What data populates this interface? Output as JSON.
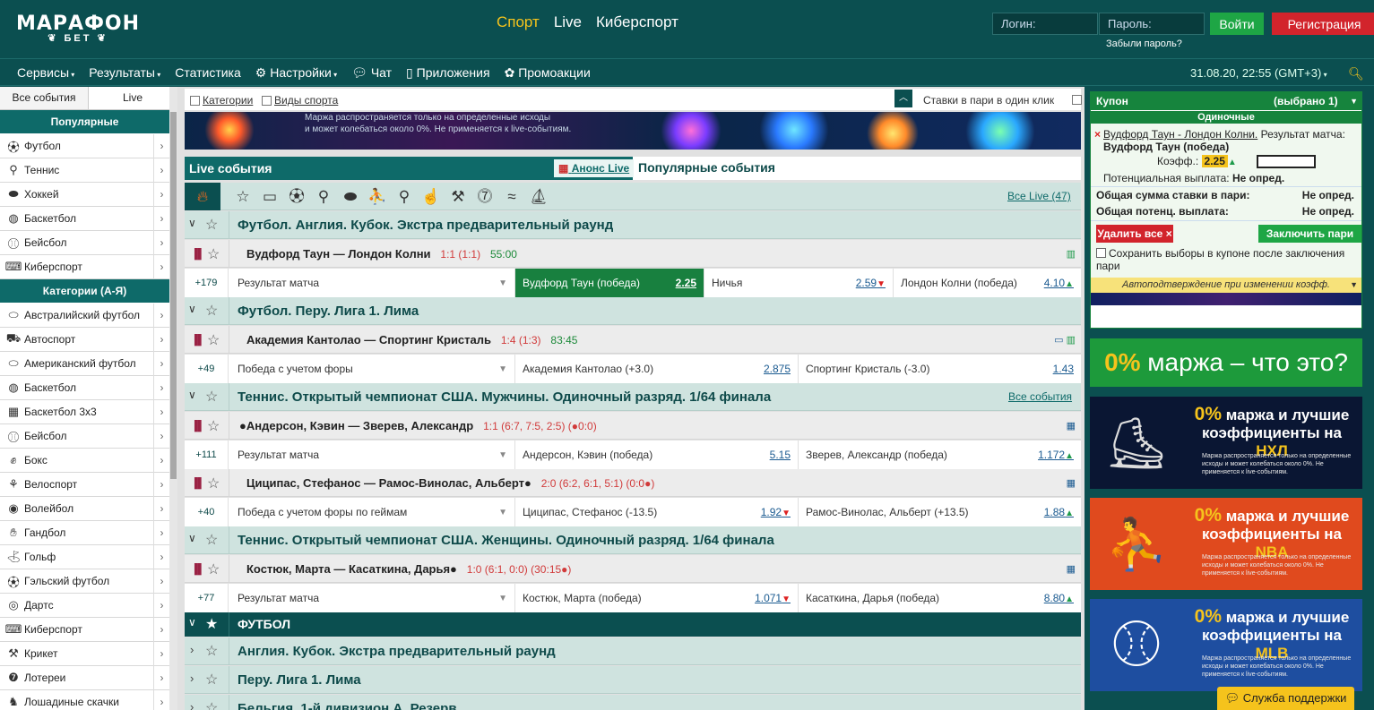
{
  "header": {
    "logo_main": "МАРАФОН",
    "logo_sub": "БЕТ",
    "nav": [
      {
        "label": "Спорт",
        "active": true
      },
      {
        "label": "Live",
        "active": false
      },
      {
        "label": "Киберспорт",
        "active": false
      }
    ],
    "login_placeholder": "Логин:",
    "password_placeholder": "Пароль:",
    "login_button": "Войти",
    "register_button": "Регистрация",
    "forgot_password": "Забыли пароль?"
  },
  "menubar": {
    "items": [
      {
        "label": "Сервисы",
        "icon": "",
        "dropdown": true
      },
      {
        "label": "Результаты",
        "icon": "",
        "dropdown": true
      },
      {
        "label": "Статистика",
        "icon": "",
        "dropdown": false
      },
      {
        "label": "Настройки",
        "icon": "gear-icon",
        "dropdown": true
      },
      {
        "label": "Чат",
        "icon": "chat-icon",
        "dropdown": false
      },
      {
        "label": "Приложения",
        "icon": "phone-icon",
        "dropdown": false
      },
      {
        "label": "Промоакции",
        "icon": "gift-icon",
        "dropdown": false
      }
    ],
    "datetime": "31.08.20, 22:55 (GMT+3)"
  },
  "sidebar": {
    "tabs": [
      "Все события",
      "Live"
    ],
    "popular_title": "Популярные",
    "popular": [
      {
        "label": "Футбол",
        "icon": "football-icon"
      },
      {
        "label": "Теннис",
        "icon": "tennis-icon"
      },
      {
        "label": "Хоккей",
        "icon": "hockey-icon"
      },
      {
        "label": "Баскетбол",
        "icon": "basketball-icon"
      },
      {
        "label": "Бейсбол",
        "icon": "baseball-icon"
      },
      {
        "label": "Киберспорт",
        "icon": "gamepad-icon"
      }
    ],
    "categories_title": "Категории (А-Я)",
    "categories": [
      {
        "label": "Австралийский футбол",
        "icon": "aussie-football-icon"
      },
      {
        "label": "Автоспорт",
        "icon": "racing-icon"
      },
      {
        "label": "Американский футбол",
        "icon": "american-football-icon"
      },
      {
        "label": "Баскетбол",
        "icon": "basketball-icon"
      },
      {
        "label": "Баскетбол 3х3",
        "icon": "basketball-3x3-icon"
      },
      {
        "label": "Бейсбол",
        "icon": "baseball-icon"
      },
      {
        "label": "Бокс",
        "icon": "boxing-icon"
      },
      {
        "label": "Велоспорт",
        "icon": "cycling-icon"
      },
      {
        "label": "Волейбол",
        "icon": "volleyball-icon"
      },
      {
        "label": "Гандбол",
        "icon": "handball-icon"
      },
      {
        "label": "Гольф",
        "icon": "golf-icon"
      },
      {
        "label": "Гэльский футбол",
        "icon": "gaelic-football-icon"
      },
      {
        "label": "Дартс",
        "icon": "darts-icon"
      },
      {
        "label": "Киберспорт",
        "icon": "gamepad-icon"
      },
      {
        "label": "Крикет",
        "icon": "cricket-icon"
      },
      {
        "label": "Лотереи",
        "icon": "lottery-icon"
      },
      {
        "label": "Лошадиные скачки",
        "icon": "horse-icon"
      }
    ]
  },
  "filterbar": {
    "categories": "Категории",
    "sports": "Виды спорта",
    "one_click": "Ставки в пари в один клик"
  },
  "banner": {
    "line1": "Маржа распространяется только на определенные исходы",
    "line2": "и может колебаться около 0%. Не применяется к live-событиям."
  },
  "tabs": {
    "live": "Live события",
    "anons": "Анонс Live",
    "popular": "Популярные события"
  },
  "sportsbar": {
    "icons": [
      "star-icon",
      "monitor-icon",
      "football-icon",
      "tennis-icon",
      "hockey-icon",
      "esport-icon",
      "table-tennis-icon",
      "volleyball-icon",
      "cricket-icon",
      "lottery-icon",
      "swimming-icon",
      "rowing-icon"
    ],
    "all_live": "Все Live (47)"
  },
  "events": {
    "league1": "Футбол. Англия. Кубок. Экстра предварительный раунд",
    "ev1": {
      "name": "Вудфорд Таун — Лондон Колни",
      "score": "1:1 (1:1)",
      "time": "55:00"
    },
    "mk1": {
      "plus": "+179",
      "market": "Результат матча",
      "o1": {
        "label": "Вудфорд Таун (победа)",
        "odd": "2.25",
        "trend": ""
      },
      "o2": {
        "label": "Ничья",
        "odd": "2.59",
        "trend": "▼"
      },
      "o3": {
        "label": "Лондон Колни (победа)",
        "odd": "4.10",
        "trend": "▲"
      }
    },
    "league2": "Футбол. Перу. Лига 1. Лима",
    "ev2": {
      "name": "Академия Кантолао — Спортинг Кристаль",
      "score": "1:4 (1:3)",
      "time": "83:45"
    },
    "mk2": {
      "plus": "+49",
      "market": "Победа с учетом форы",
      "o1": {
        "label": "Академия Кантолао (+3.0)",
        "odd": "2.875",
        "trend": ""
      },
      "o2": {
        "label": "Спортинг Кристаль  (-3.0)",
        "odd": "1.43",
        "trend": ""
      }
    },
    "league3": "Теннис. Открытый чемпионат США. Мужчины. Одиночный разряд. 1/64 финала",
    "league3_all": "Все события",
    "ev3": {
      "name": "●Андерсон, Кэвин — Зверев, Александр",
      "score": "1:1 (6:7, 7:5, 2:5) (●0:0)"
    },
    "mk3": {
      "plus": "+111",
      "market": "Результат матча",
      "o1": {
        "label": "Андерсон, Кэвин (победа)",
        "odd": "5.15",
        "trend": ""
      },
      "o2": {
        "label": "Зверев, Александр (победа)",
        "odd": "1.172",
        "trend": "▲"
      }
    },
    "ev4": {
      "name": "Циципас, Стефанос — Рамос-Винолас, Альберт●",
      "score": "2:0 (6:2, 6:1, 5:1) (0:0●)"
    },
    "mk4": {
      "plus": "+40",
      "market": "Победа с учетом форы по геймам",
      "o1": {
        "label": "Циципас, Стефанос (-13.5)",
        "odd": "1.92",
        "trend": "▼"
      },
      "o2": {
        "label": "Рамос-Винолас, Альберт  (+13.5)",
        "odd": "1.88",
        "trend": "▲"
      }
    },
    "league4": "Теннис. Открытый чемпионат США. Женщины. Одиночный разряд. 1/64 финала",
    "ev5": {
      "name": "Костюк, Марта — Касаткина, Дарья●",
      "score": "1:0 (6:1, 0:0) (30:15●)"
    },
    "mk5": {
      "plus": "+77",
      "market": "Результат матча",
      "o1": {
        "label": "Костюк, Марта (победа)",
        "odd": "1.071",
        "trend": "▼"
      },
      "o2": {
        "label": "Касаткина, Дарья (победа)",
        "odd": "8.80",
        "trend": "▲"
      }
    },
    "football_title": "ФУТБОЛ",
    "sub1": "Англия. Кубок. Экстра предварительный раунд",
    "sub2": "Перу. Лига 1. Лима",
    "sub3": "Бельгия. 1-й дивизион А. Резерв"
  },
  "coupon": {
    "title": "Купон",
    "selected": "(выбрано 1)",
    "singles": "Одиночные",
    "bet_event": "Вудфорд Таун - Лондон Колни.",
    "bet_market": "Результат матча:",
    "bet_outcome": "Вудфорд Таун (победа)",
    "coef_label": "Коэфф.:",
    "coef_value": "2.25",
    "payout_label": "Потенциальная выплата:",
    "payout_value": "Не опред.",
    "total_stake_label": "Общая сумма ставки в пари:",
    "total_stake_value": "Не опред.",
    "total_payout_label": "Общая потенц. выплата:",
    "total_payout_value": "Не опред.",
    "delete_all": "Удалить все",
    "confirm": "Заключить пари",
    "save_label": "Сохранить выборы в купоне после заключения пари",
    "auto_confirm": "Автоподтверждение при изменении коэфф."
  },
  "ads": {
    "ad0_pct": "0%",
    "ad0_text": " маржа – что это?",
    "ad1": {
      "pct": "0%",
      "line": " маржа и лучшие коэффициенты на ",
      "league": "НХЛ",
      "small": "Маржа распространяется только на определенные исходы и может колебаться около 0%. Не применяется к live-событиям."
    },
    "ad2": {
      "pct": "0%",
      "line": " маржа и лучшие коэффициенты на ",
      "league": "NBA",
      "small": "Маржа распространяется только на определенные исходы и может колебаться около 0%. Не применяется к live-событиям."
    },
    "ad3": {
      "pct": "0%",
      "line": " маржа и лучшие коэффициенты на ",
      "league": "MLB",
      "small": "Маржа распространяется только на определенные исходы и может колебаться около 0%. Не применяется к live-событиям."
    }
  },
  "support": "Служба поддержки"
}
